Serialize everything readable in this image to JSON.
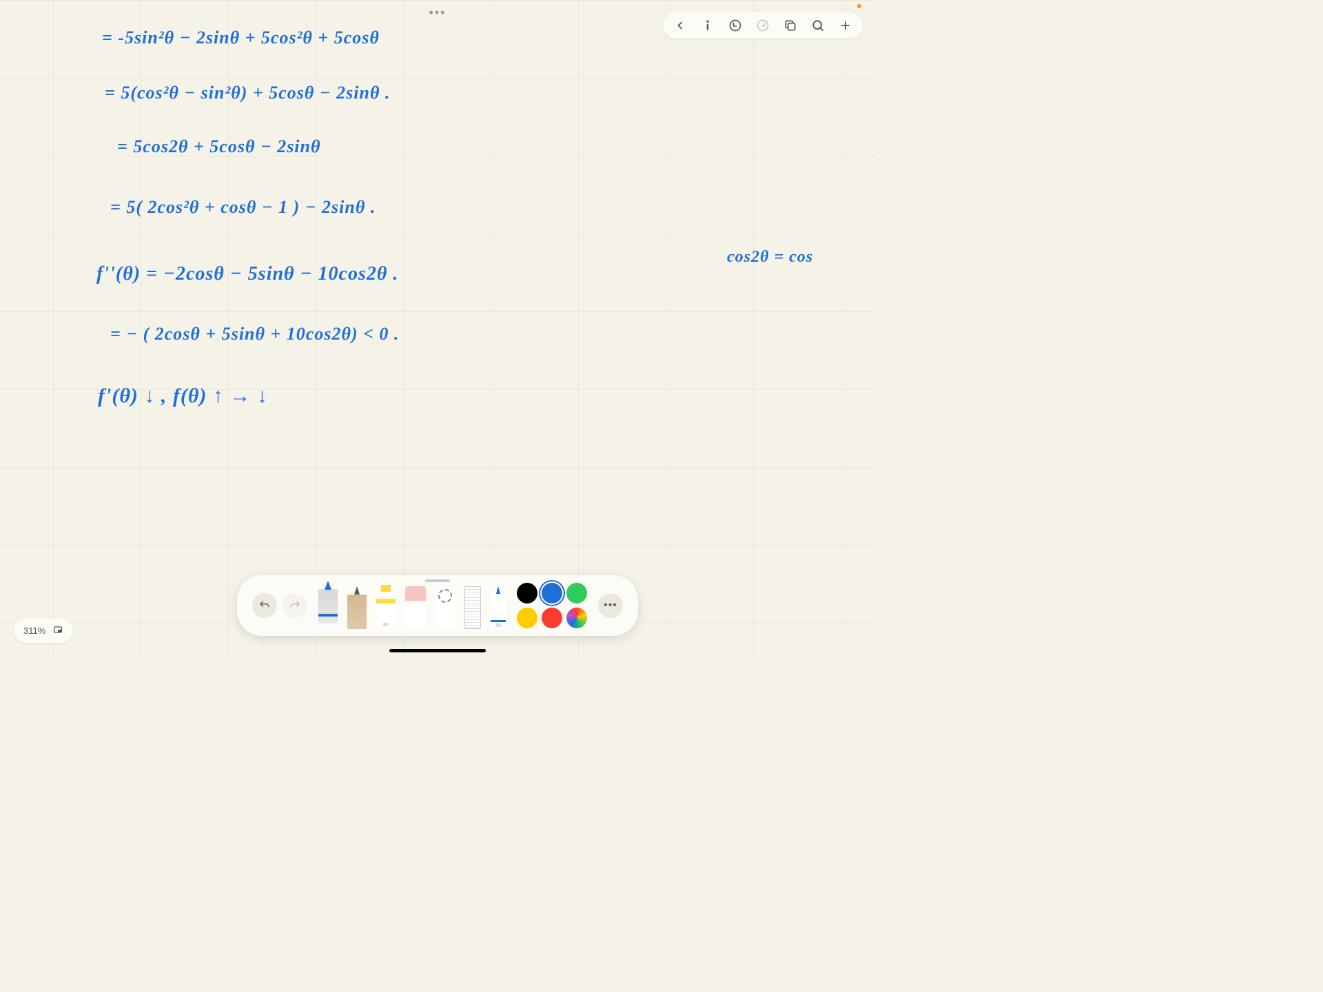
{
  "zoom": {
    "level": "311%"
  },
  "handwriting": {
    "line1": "= -5sin²θ  − 2sinθ + 5cos²θ + 5cosθ",
    "line2": "= 5(cos²θ − sin²θ)  + 5cosθ − 2sinθ .",
    "line3": "=   5cos2θ + 5cosθ − 2sinθ",
    "line4": "=  5( 2cos²θ + cosθ − 1 ) − 2sinθ .",
    "line5": "f''(θ) = −2cosθ  − 5sinθ − 10cos2θ .",
    "line6": "= − ( 2cosθ + 5sinθ + 10cos2θ) < 0 .",
    "line7": "f'(θ)  ↓    ,  f(θ)  ↑  →  ↓",
    "side1": "cos2θ =  cos"
  },
  "tools": {
    "marker_label": "80",
    "finepen_label": "50"
  },
  "colors": {
    "black": "#000000",
    "blue": "#1e6fd9",
    "green": "#2ecc5a",
    "yellow": "#ffcc00",
    "red": "#ff3b30"
  }
}
